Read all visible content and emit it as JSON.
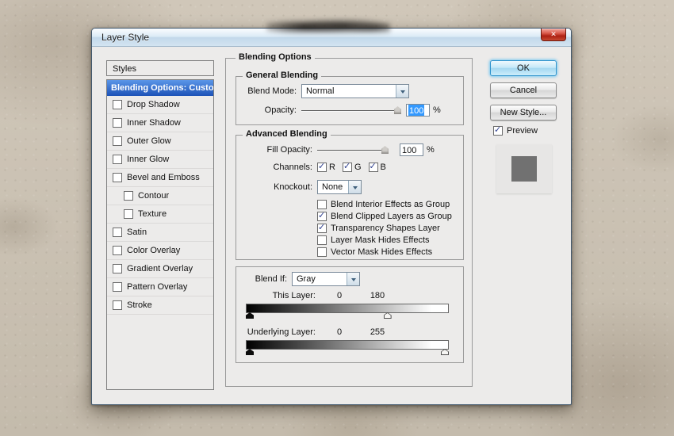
{
  "dialog": {
    "title": "Layer Style",
    "close_glyph": "✕"
  },
  "styles_panel": {
    "header": "Styles",
    "selected_item": "Blending Options: Custom",
    "items": [
      {
        "label": "Drop Shadow",
        "checked": false
      },
      {
        "label": "Inner Shadow",
        "checked": false
      },
      {
        "label": "Outer Glow",
        "checked": false
      },
      {
        "label": "Inner Glow",
        "checked": false
      },
      {
        "label": "Bevel and Emboss",
        "checked": false
      },
      {
        "label": "Contour",
        "checked": false
      },
      {
        "label": "Texture",
        "checked": false
      },
      {
        "label": "Satin",
        "checked": false
      },
      {
        "label": "Color Overlay",
        "checked": false
      },
      {
        "label": "Gradient Overlay",
        "checked": false
      },
      {
        "label": "Pattern Overlay",
        "checked": false
      },
      {
        "label": "Stroke",
        "checked": false
      }
    ]
  },
  "main": {
    "title": "Blending Options",
    "general": {
      "legend": "General Blending",
      "blend_mode_label": "Blend Mode:",
      "blend_mode_value": "Normal",
      "opacity_label": "Opacity:",
      "opacity_value": "100",
      "opacity_unit": "%"
    },
    "advanced": {
      "legend": "Advanced Blending",
      "fill_opacity_label": "Fill Opacity:",
      "fill_opacity_value": "100",
      "fill_opacity_unit": "%",
      "channels_label": "Channels:",
      "channels": [
        {
          "label": "R",
          "checked": true
        },
        {
          "label": "G",
          "checked": true
        },
        {
          "label": "B",
          "checked": true
        }
      ],
      "knockout_label": "Knockout:",
      "knockout_value": "None",
      "options": [
        {
          "label": "Blend Interior Effects as Group",
          "checked": false
        },
        {
          "label": "Blend Clipped Layers as Group",
          "checked": true
        },
        {
          "label": "Transparency Shapes Layer",
          "checked": true
        },
        {
          "label": "Layer Mask Hides Effects",
          "checked": false
        },
        {
          "label": "Vector Mask Hides Effects",
          "checked": false
        }
      ]
    },
    "blend_if": {
      "label": "Blend If:",
      "value": "Gray",
      "this_layer_label": "This Layer:",
      "this_layer_min": "0",
      "this_layer_max": "180",
      "underlying_label": "Underlying Layer:",
      "underlying_min": "0",
      "underlying_max": "255"
    }
  },
  "actions": {
    "ok": "OK",
    "cancel": "Cancel",
    "new_style": "New Style...",
    "preview_label": "Preview",
    "preview_checked": true
  },
  "colors": {
    "selection_blue": "#1c52b7",
    "selection_blue_top": "#5b96e8",
    "highlight_blue": "#3399ff",
    "swatch_gray": "#717171"
  }
}
